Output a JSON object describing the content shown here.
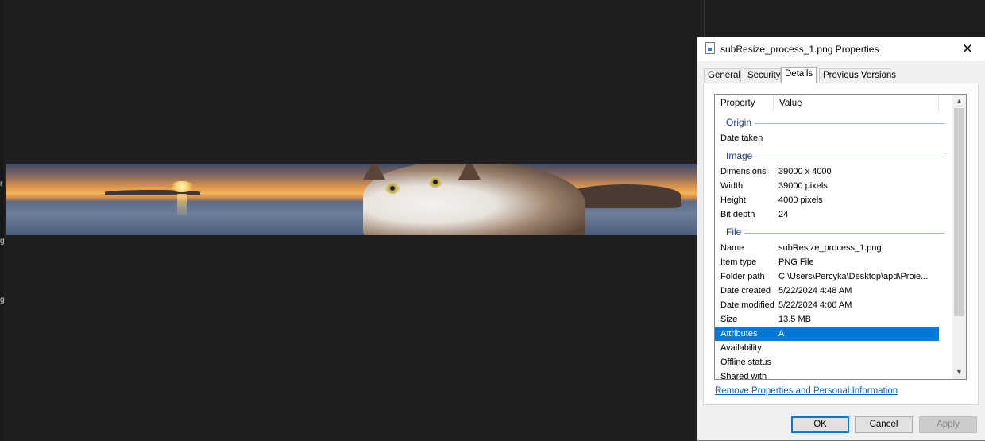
{
  "viewer": {
    "edge_glyphs": [
      "r",
      "g",
      "g"
    ]
  },
  "dialog": {
    "title": "subResize_process_1.png Properties",
    "close_glyph": "✕",
    "tabs": [
      {
        "label": "General"
      },
      {
        "label": "Security"
      },
      {
        "label": "Details"
      },
      {
        "label": "Previous Versions"
      }
    ],
    "active_tab": "Details",
    "columns": {
      "property": "Property",
      "value": "Value"
    },
    "groups": {
      "origin": "Origin",
      "image": "Image",
      "file": "File"
    },
    "origin_rows": [
      {
        "property": "Date taken",
        "value": ""
      }
    ],
    "image_rows": [
      {
        "property": "Dimensions",
        "value": "39000 x 4000"
      },
      {
        "property": "Width",
        "value": "39000 pixels"
      },
      {
        "property": "Height",
        "value": "4000 pixels"
      },
      {
        "property": "Bit depth",
        "value": "24"
      }
    ],
    "file_rows": [
      {
        "property": "Name",
        "value": "subResize_process_1.png"
      },
      {
        "property": "Item type",
        "value": "PNG File"
      },
      {
        "property": "Folder path",
        "value": "C:\\Users\\Percyka\\Desktop\\apd\\Proie..."
      },
      {
        "property": "Date created",
        "value": "5/22/2024 4:48 AM"
      },
      {
        "property": "Date modified",
        "value": "5/22/2024 4:00 AM"
      },
      {
        "property": "Size",
        "value": "13.5 MB"
      },
      {
        "property": "Attributes",
        "value": "A"
      },
      {
        "property": "Availability",
        "value": ""
      },
      {
        "property": "Offline status",
        "value": ""
      },
      {
        "property": "Shared with",
        "value": ""
      }
    ],
    "selected_property": "Attributes",
    "remove_link": "Remove Properties and Personal Information",
    "buttons": {
      "ok": "OK",
      "cancel": "Cancel",
      "apply": "Apply"
    },
    "scroll_arrows": {
      "up": "▲",
      "down": "▼"
    }
  },
  "colors": {
    "selection": "#0078d7",
    "group_header": "#1e3c87",
    "link": "#0066cc",
    "viewer_background": "#1f1f1f"
  }
}
